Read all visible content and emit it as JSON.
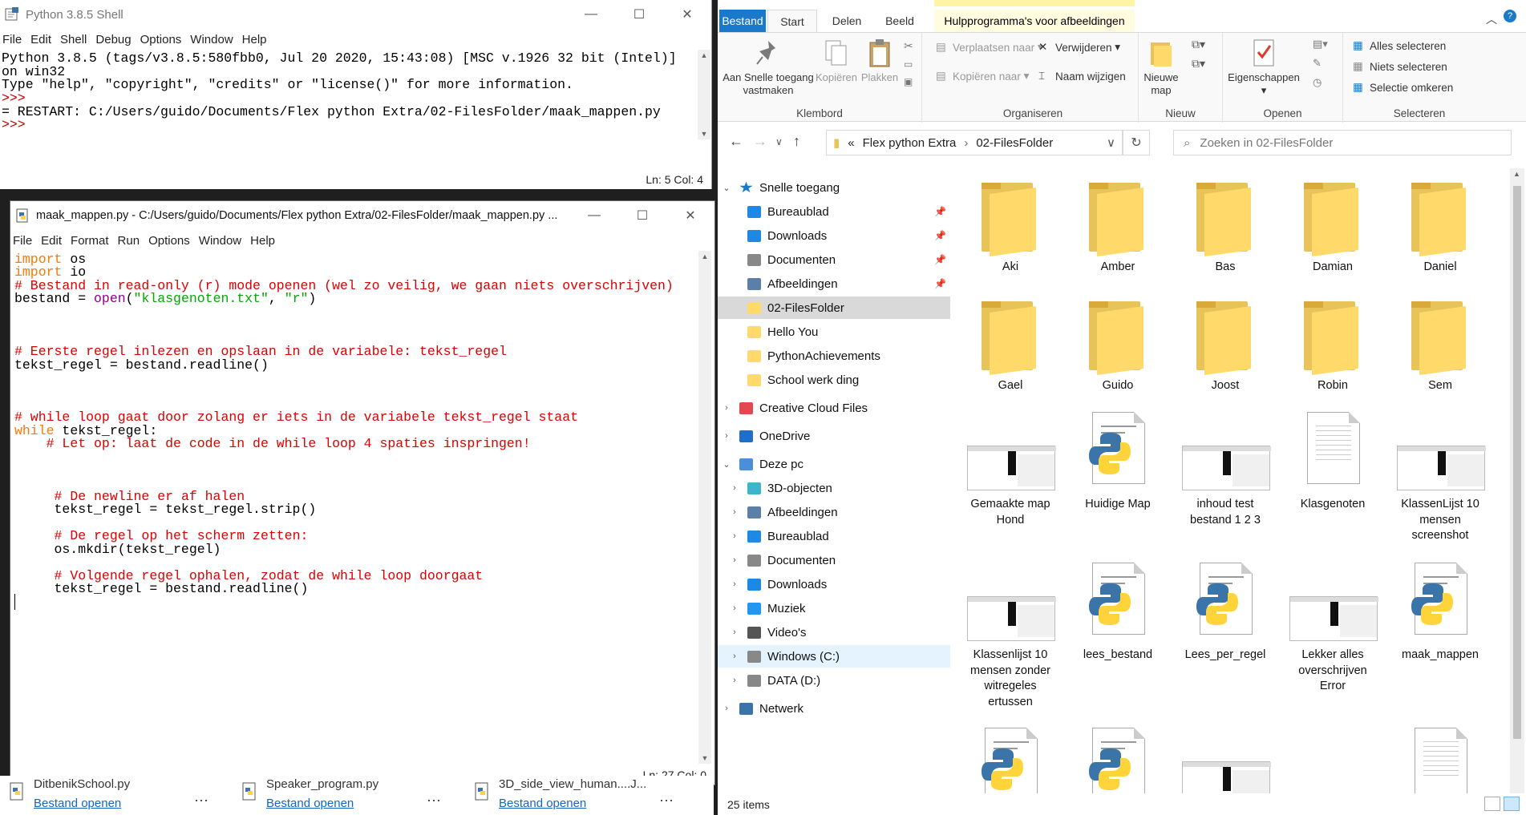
{
  "shell": {
    "title": "Python 3.8.5 Shell",
    "menu": [
      "File",
      "Edit",
      "Shell",
      "Debug",
      "Options",
      "Window",
      "Help"
    ],
    "lines": [
      {
        "text": "Python 3.8.5 (tags/v3.8.5:580fbb0, Jul 20 2020, 15:43:08) [MSC v.1926 32 bit (Intel)]",
        "kind": "out"
      },
      {
        "text": "on win32",
        "kind": "out"
      },
      {
        "text": "Type \"help\", \"copyright\", \"credits\" or \"license()\" for more information.",
        "kind": "out"
      },
      {
        "text": ">>> ",
        "kind": "prompt"
      },
      {
        "text": "= RESTART: C:/Users/guido/Documents/Flex python Extra/02-FilesFolder/maak_mappen.py",
        "kind": "out"
      },
      {
        "text": ">>> ",
        "kind": "prompt"
      }
    ],
    "status": "Ln: 5   Col: 4"
  },
  "editor": {
    "title": "maak_mappen.py - C:/Users/guido/Documents/Flex python Extra/02-FilesFolder/maak_mappen.py ...",
    "menu": [
      "File",
      "Edit",
      "Format",
      "Run",
      "Options",
      "Window",
      "Help"
    ],
    "status": "Ln: 27   Col: 0",
    "code": [
      [
        [
          "kw",
          "import"
        ],
        [
          "n",
          " os"
        ]
      ],
      [
        [
          "kw",
          "import"
        ],
        [
          "n",
          " io"
        ]
      ],
      [
        [
          "cm",
          "# Bestand in read-only (r) mode openen (wel zo veilig, we gaan niets overschrijven)"
        ]
      ],
      [
        [
          "n",
          "bestand = "
        ],
        [
          "bi",
          "open"
        ],
        [
          "n",
          "("
        ],
        [
          "st",
          "\"klasgenoten.txt\""
        ],
        [
          "n",
          ", "
        ],
        [
          "st",
          "\"r\""
        ],
        [
          "n",
          ")"
        ]
      ],
      [],
      [],
      [],
      [
        [
          "cm",
          "# Eerste regel inlezen en opslaan in de variabele: tekst_regel"
        ]
      ],
      [
        [
          "n",
          "tekst_regel = bestand.readline()"
        ]
      ],
      [],
      [],
      [],
      [
        [
          "cm",
          "# while loop gaat door zolang er iets in de variabele tekst_regel staat"
        ]
      ],
      [
        [
          "kw",
          "while"
        ],
        [
          "n",
          " tekst_regel:"
        ]
      ],
      [
        [
          "n",
          "    "
        ],
        [
          "cm",
          "# Let op: laat de code in de while loop 4 spaties inspringen!"
        ]
      ],
      [],
      [],
      [],
      [
        [
          "n",
          "     "
        ],
        [
          "cm",
          "# De newline er af halen"
        ]
      ],
      [
        [
          "n",
          "     tekst_regel = tekst_regel.strip()"
        ]
      ],
      [],
      [
        [
          "n",
          "     "
        ],
        [
          "cm",
          "# De regel op het scherm zetten:"
        ]
      ],
      [
        [
          "n",
          "     os.mkdir(tekst_regel)"
        ]
      ],
      [],
      [
        [
          "n",
          "     "
        ],
        [
          "cm",
          "# Volgende regel ophalen, zodat de while loop doorgaat"
        ]
      ],
      [
        [
          "n",
          "     tekst_regel = bestand.readline()"
        ]
      ],
      [
        [
          "caret",
          ""
        ]
      ]
    ]
  },
  "recent": [
    {
      "name": "DitbenikSchool.py",
      "link": "Bestand openen"
    },
    {
      "name": "Speaker_program.py",
      "link": "Bestand openen"
    },
    {
      "name": "3D_side_view_human....J...",
      "link": "Bestand openen"
    }
  ],
  "explorer": {
    "tabs": {
      "file": "Bestand",
      "start": "Start",
      "share": "Delen",
      "view": "Beeld",
      "manage": "Hulpprogramma's voor afbeeldingen"
    },
    "ribbon": {
      "pin": "Aan Snelle toegang vastmaken",
      "copy": "Kopiëren",
      "paste": "Plakken",
      "group_clipboard": "Klembord",
      "move_to": "Verplaatsen naar",
      "copy_to": "Kopiëren naar",
      "delete": "Verwijderen",
      "rename": "Naam wijzigen",
      "group_organize": "Organiseren",
      "new_folder": "Nieuwe map",
      "group_new": "Nieuw",
      "properties": "Eigenschappen",
      "group_open": "Openen",
      "select_all": "Alles selecteren",
      "select_none": "Niets selecteren",
      "invert": "Selectie omkeren",
      "group_select": "Selecteren"
    },
    "address": {
      "root": "«",
      "seg1": "Flex python Extra",
      "seg2": "02-FilesFolder"
    },
    "search_placeholder": "Zoeken in 02-FilesFolder",
    "nav": [
      {
        "label": "Snelle toegang",
        "level": 0,
        "chev": "v",
        "icon": "star",
        "pin": false
      },
      {
        "label": "Bureaublad",
        "level": 1,
        "chev": "",
        "icon": "desktop",
        "pin": true
      },
      {
        "label": "Downloads",
        "level": 1,
        "chev": "",
        "icon": "download",
        "pin": true
      },
      {
        "label": "Documenten",
        "level": 1,
        "chev": "",
        "icon": "doc",
        "pin": true
      },
      {
        "label": "Afbeeldingen",
        "level": 1,
        "chev": "",
        "icon": "image",
        "pin": true
      },
      {
        "label": "02-FilesFolder",
        "level": 1,
        "chev": "",
        "icon": "folder",
        "pin": false,
        "selected": true
      },
      {
        "label": "Hello You",
        "level": 1,
        "chev": "",
        "icon": "folder",
        "pin": false
      },
      {
        "label": "PythonAchievements",
        "level": 1,
        "chev": "",
        "icon": "folder",
        "pin": false
      },
      {
        "label": "School werk ding",
        "level": 1,
        "chev": "",
        "icon": "folder",
        "pin": false
      },
      {
        "label": "Creative Cloud Files",
        "level": 0,
        "chev": ">",
        "icon": "cc",
        "pin": false,
        "gap": true
      },
      {
        "label": "OneDrive",
        "level": 0,
        "chev": ">",
        "icon": "cloud",
        "pin": false,
        "gap": true
      },
      {
        "label": "Deze pc",
        "level": 0,
        "chev": "v",
        "icon": "pc",
        "pin": false,
        "gap": true
      },
      {
        "label": "3D-objecten",
        "level": 1,
        "chev": ">",
        "icon": "cube",
        "pin": false
      },
      {
        "label": "Afbeeldingen",
        "level": 1,
        "chev": ">",
        "icon": "image",
        "pin": false
      },
      {
        "label": "Bureaublad",
        "level": 1,
        "chev": ">",
        "icon": "desktop",
        "pin": false
      },
      {
        "label": "Documenten",
        "level": 1,
        "chev": ">",
        "icon": "doc",
        "pin": false
      },
      {
        "label": "Downloads",
        "level": 1,
        "chev": ">",
        "icon": "download",
        "pin": false
      },
      {
        "label": "Muziek",
        "level": 1,
        "chev": ">",
        "icon": "music",
        "pin": false
      },
      {
        "label": "Video's",
        "level": 1,
        "chev": ">",
        "icon": "video",
        "pin": false
      },
      {
        "label": "Windows (C:)",
        "level": 1,
        "chev": ">",
        "icon": "drive",
        "pin": false,
        "hover": true
      },
      {
        "label": "DATA (D:)",
        "level": 1,
        "chev": ">",
        "icon": "drive",
        "pin": false
      },
      {
        "label": "Netwerk",
        "level": 0,
        "chev": ">",
        "icon": "network",
        "pin": false,
        "gap": true
      }
    ],
    "items": [
      {
        "name": "Aki",
        "type": "folder"
      },
      {
        "name": "Amber",
        "type": "folder"
      },
      {
        "name": "Bas",
        "type": "folder"
      },
      {
        "name": "Damian",
        "type": "folder"
      },
      {
        "name": "Daniel",
        "type": "folder"
      },
      {
        "name": "Gael",
        "type": "folder"
      },
      {
        "name": "Guido",
        "type": "folder"
      },
      {
        "name": "Joost",
        "type": "folder"
      },
      {
        "name": "Robin",
        "type": "folder"
      },
      {
        "name": "Sem",
        "type": "folder"
      },
      {
        "name": "Gemaakte map Hond",
        "type": "shot"
      },
      {
        "name": "Huidige Map",
        "type": "py"
      },
      {
        "name": "inhoud test bestand 1 2 3",
        "type": "shot"
      },
      {
        "name": "Klasgenoten",
        "type": "txt"
      },
      {
        "name": "KlassenLijst 10 mensen screenshot",
        "type": "shot"
      },
      {
        "name": "Klassenlijst 10 mensen zonder witregeles ertussen",
        "type": "shot"
      },
      {
        "name": "lees_bestand",
        "type": "py"
      },
      {
        "name": "Lees_per_regel",
        "type": "py"
      },
      {
        "name": "Lekker alles overschrijven Error",
        "type": "shot"
      },
      {
        "name": "maak_mappen",
        "type": "py"
      },
      {
        "name": "",
        "type": "py"
      },
      {
        "name": "",
        "type": "py"
      },
      {
        "name": "",
        "type": "shot"
      },
      {
        "name": "",
        "type": "blank"
      },
      {
        "name": "",
        "type": "txt"
      }
    ],
    "status": "25 items"
  },
  "colors": {
    "keyword": "#ff7700",
    "comment": "#dd0000",
    "string": "#00aa00",
    "builtin": "#900090",
    "accent": "#1979ca",
    "folder": "#ffd96a"
  }
}
